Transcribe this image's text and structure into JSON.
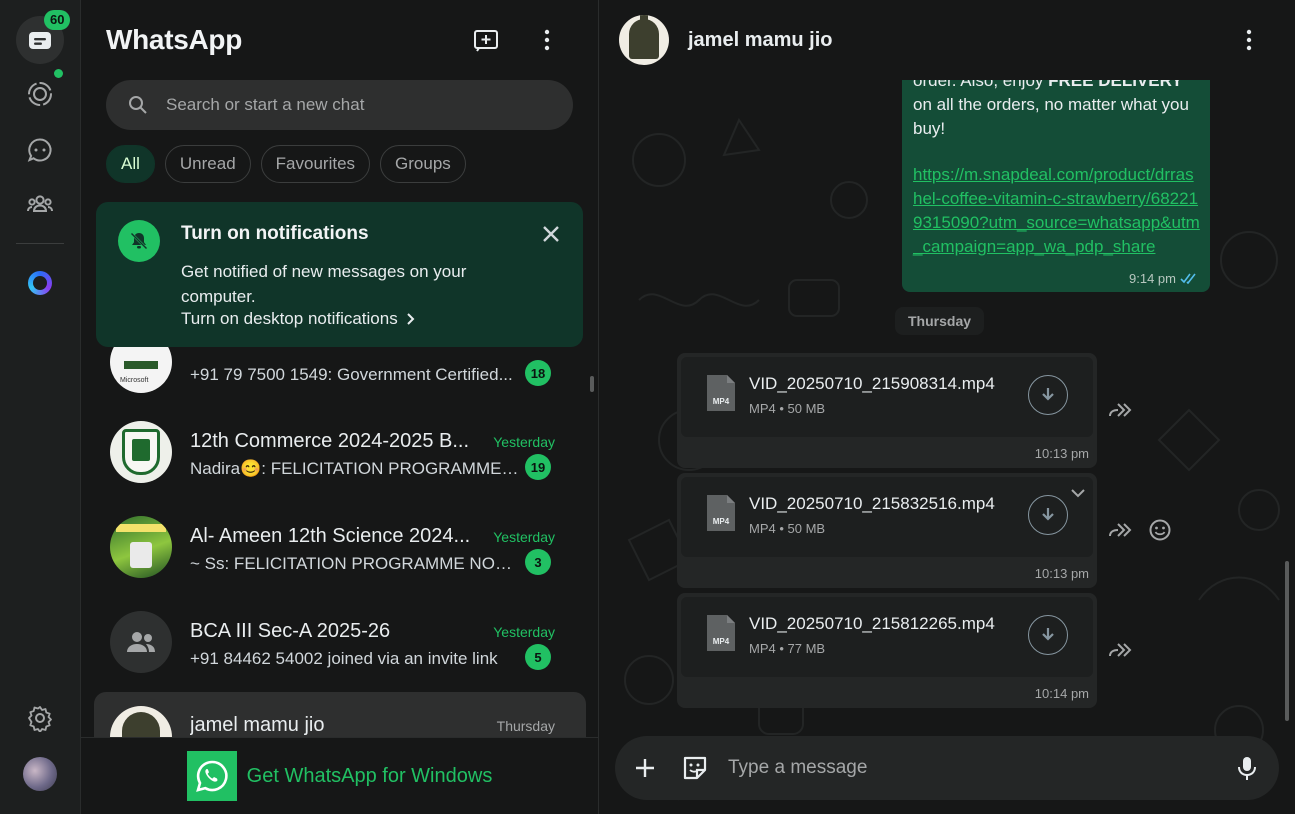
{
  "rail": {
    "unread_count": "60"
  },
  "list": {
    "title": "WhatsApp",
    "search_placeholder": "Search or start a new chat",
    "filters": [
      "All",
      "Unread",
      "Favourites",
      "Groups"
    ],
    "notification": {
      "title": "Turn on notifications",
      "body": "Get notified of new messages on your computer.",
      "link": "Turn on desktop notifications"
    },
    "chats": [
      {
        "name": "",
        "time": "",
        "message": "+91 79 7500 1549: Government Certified...",
        "unread": "18"
      },
      {
        "name": "12th Commerce 2024-2025 B...",
        "time": "Yesterday",
        "message": "Nadira😊: FELICITATION PROGRAMME ...",
        "unread": "19"
      },
      {
        "name": "Al- Ameen 12th Science 2024...",
        "time": "Yesterday",
        "message": "~ Ss: FELICITATION PROGRAMME NOTIC...",
        "unread": "3"
      },
      {
        "name": "BCA III Sec-A 2025-26",
        "time": "Yesterday",
        "message": "+91 84462 54002 joined via an invite link",
        "unread": "5"
      },
      {
        "name": "jamel mamu jio",
        "time": "Thursday",
        "message": "",
        "unread": ""
      }
    ],
    "get_windows": "Get WhatsApp for Windows"
  },
  "conversation": {
    "contact_name": "jamel mamu jio",
    "promo_message": {
      "text_prefix": "order. Also, enjoy ",
      "text_bold": "FREE DELIVERY",
      "text_suffix": " on all the orders, no matter what you buy!",
      "link": "https://m.snapdeal.com/product/drrashel-coffee-vitamin-c-strawberry/682219315090?utm_source=whatsapp&utm_campaign=app_wa_pdp_share",
      "time": "9:14 pm"
    },
    "day_divider": "Thursday",
    "files": [
      {
        "name": "VID_20250710_215908314.mp4",
        "type": "MP4",
        "size": "50 MB",
        "time": "10:13 pm"
      },
      {
        "name": "VID_20250710_215832516.mp4",
        "type": "MP4",
        "size": "50 MB",
        "time": "10:13 pm"
      },
      {
        "name": "VID_20250710_215812265.mp4",
        "type": "MP4",
        "size": "77 MB",
        "time": "10:14 pm"
      }
    ],
    "composer_placeholder": "Type a message"
  },
  "colors": {
    "accent": "#21c063",
    "outgoing_bubble": "#144d37",
    "notification_bg": "#103529"
  }
}
